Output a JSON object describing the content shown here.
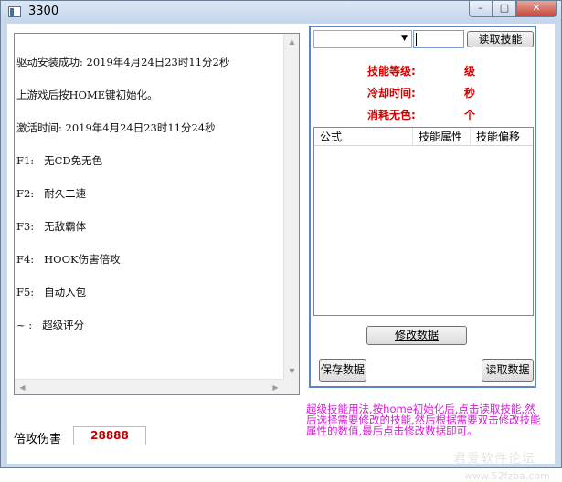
{
  "window": {
    "title": "3300",
    "minimize": "–",
    "maximize": "□",
    "close": "✕"
  },
  "log": {
    "lines": [
      "驱动安装成功: 2019年4月24日23时11分2秒",
      "上游戏后按HOME键初始化。",
      "激活时间: 2019年4月24日23时11分24秒",
      "F1:   无CD免无色",
      "F2:   耐久二速",
      "F3:   无敌霸体",
      "F4:   HOOK伤害倍攻",
      "F5:   自动入包",
      "~ :   超级评分"
    ]
  },
  "damage": {
    "label": "倍攻伤害",
    "value": "28888"
  },
  "skill": {
    "read_button": "读取技能",
    "combo_value": "",
    "text_value": "",
    "level_label": "技能等级:",
    "level_unit": "级",
    "cooldown_label": "冷却时间:",
    "cooldown_unit": "秒",
    "cost_label": "消耗无色:",
    "cost_unit": "个"
  },
  "table": {
    "columns": [
      "公式",
      "技能属性",
      "技能偏移"
    ],
    "rows": []
  },
  "actions": {
    "modify": "修改数据",
    "save": "保存数据",
    "read": "读取数据"
  },
  "help_text": "超级技能用法,按home初始化后,点击读取技能,然后选择需要修改的技能,然后根据需要双击修改技能属性的数值,最后点击修改数据即可。",
  "watermark": {
    "text": "君爱软件论坛",
    "url": "www.52fzba.com"
  },
  "colors": {
    "accent_red": "#d40000",
    "help_magenta": "#d21cd2",
    "panel_border": "#5a86c6"
  }
}
